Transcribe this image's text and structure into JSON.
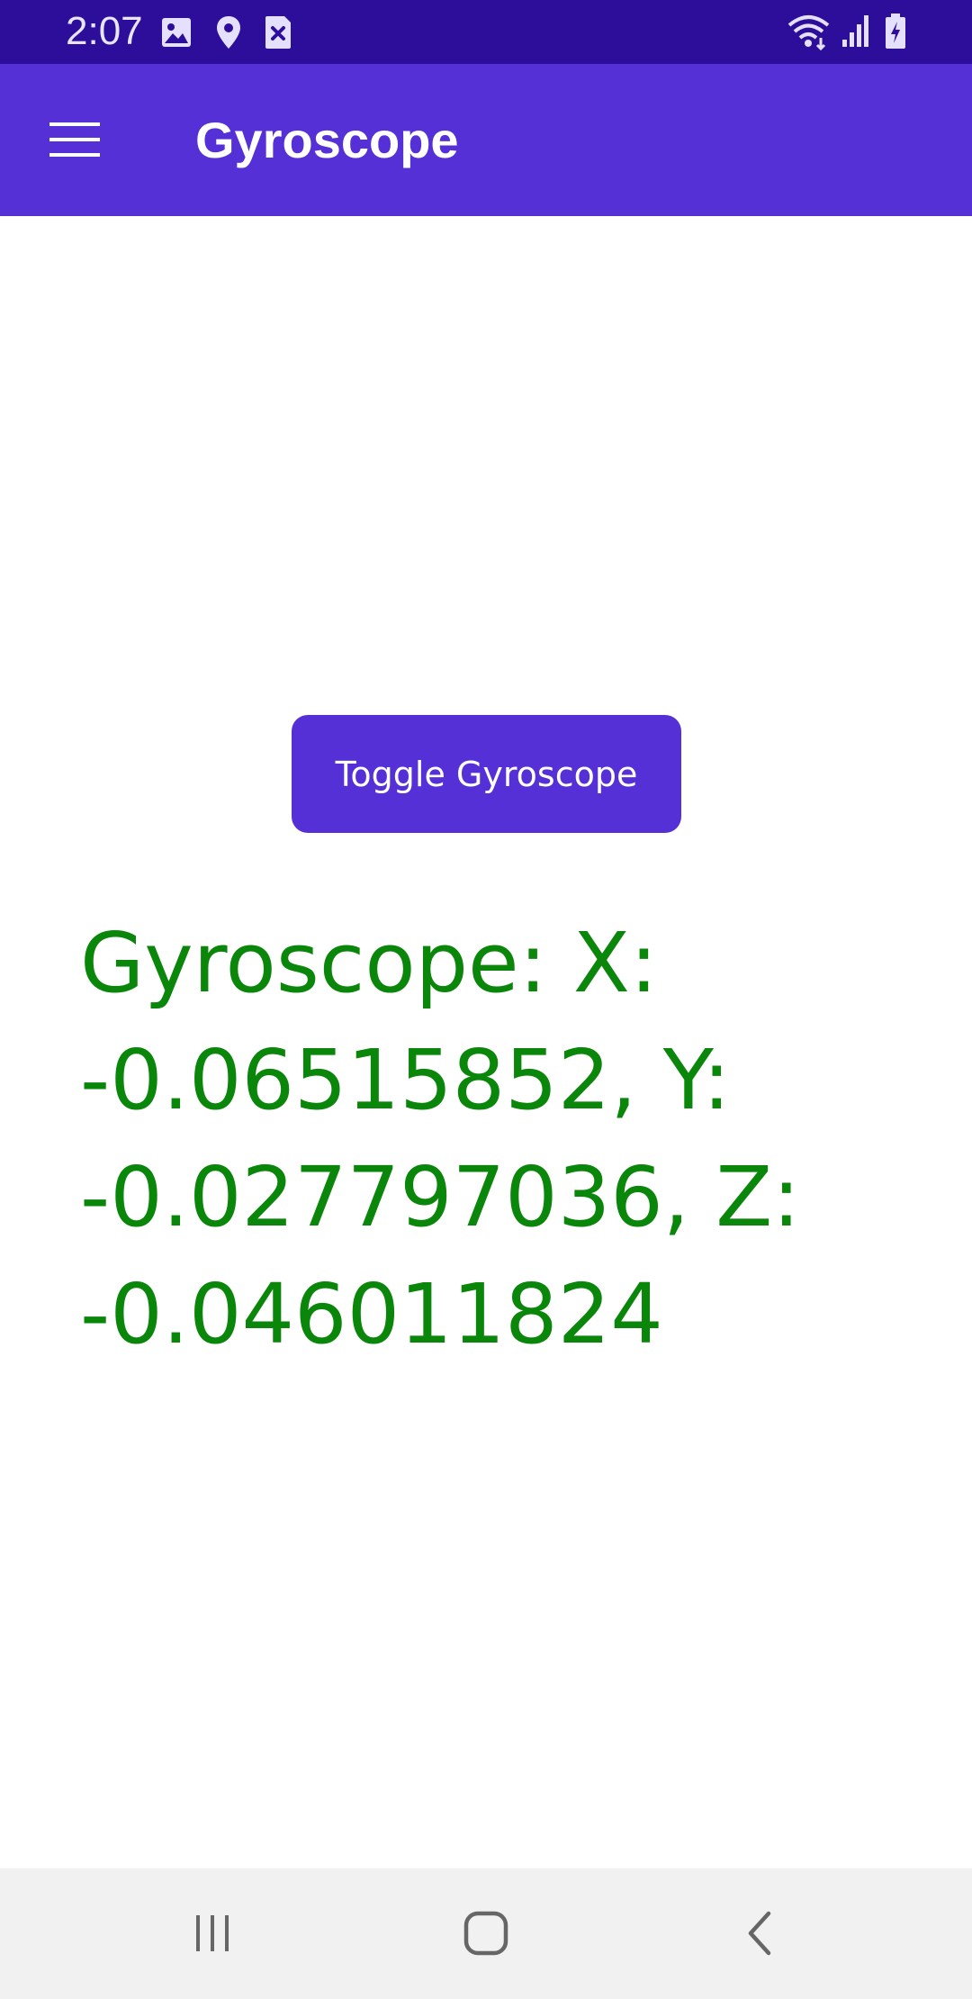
{
  "status_bar": {
    "time": "2:07",
    "left_icons": [
      "image-icon",
      "location-pin-icon",
      "close-box-icon"
    ],
    "right_icons": [
      "wifi-icon",
      "signal-icon",
      "battery-charging-icon"
    ]
  },
  "app_bar": {
    "title": "Gyroscope",
    "menu_icon": "hamburger-menu-icon"
  },
  "main": {
    "toggle_button_label": "Toggle Gyroscope",
    "gyro_lines": [
      "Gyroscope: X:",
      "-0.06515852, Y:",
      "-0.027797036, Z:",
      "-0.046011824"
    ]
  },
  "nav_bar": {
    "icons": [
      "recent-apps-icon",
      "home-icon",
      "back-icon"
    ]
  },
  "colors": {
    "status_bar": "#2c0e9a",
    "primary": "#5430d6",
    "gyro_text": "#0a860a",
    "nav_bar": "#f1f1f1"
  }
}
